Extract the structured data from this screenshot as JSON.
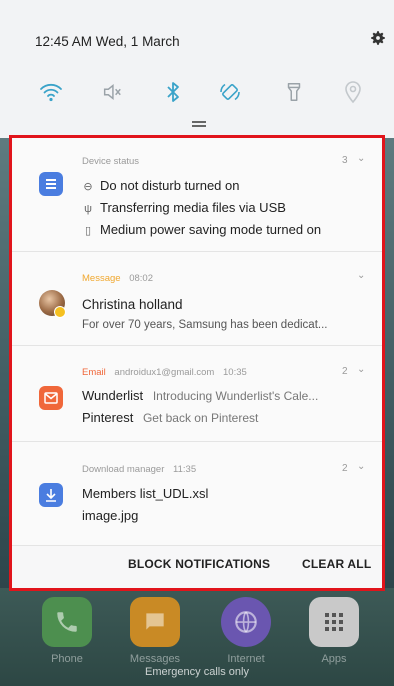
{
  "status_bar": {
    "time_date": "12:45 AM  Wed, 1 March"
  },
  "quick_settings": {
    "icons": [
      "wifi-icon",
      "sound-off-icon",
      "bluetooth-icon",
      "auto-rotate-icon",
      "flashlight-icon",
      "location-icon"
    ],
    "accent_color": "#3aa3c9"
  },
  "notifications": {
    "device_status": {
      "header": "Device status",
      "count": "3",
      "lines": [
        {
          "icon": "do-not-disturb-icon",
          "text": "Do not disturb turned on"
        },
        {
          "icon": "usb-icon",
          "text": "Transferring media files via USB"
        },
        {
          "icon": "battery-icon",
          "text": "Medium power saving mode turned on"
        }
      ]
    },
    "message": {
      "app": "Message",
      "time": "08:02",
      "title": "Christina holland",
      "body": "For over 70 years, Samsung has been dedicat..."
    },
    "email": {
      "app": "Email",
      "account": "androidux1@gmail.com",
      "time": "10:35",
      "count": "2",
      "rows": [
        {
          "sender": "Wunderlist",
          "subject": "Introducing Wunderlist's Cale..."
        },
        {
          "sender": "Pinterest",
          "subject": "Get back on Pinterest"
        }
      ]
    },
    "download": {
      "app": "Download manager",
      "time": "11:35",
      "count": "2",
      "files": [
        "Members list_UDL.xsl",
        "image.jpg"
      ]
    }
  },
  "actions": {
    "block": "BLOCK NOTIFICATIONS",
    "clear": "CLEAR ALL"
  },
  "dock": {
    "apps": [
      {
        "label": "Phone",
        "color": "#4d8f4f"
      },
      {
        "label": "Messages",
        "color": "#c98a25"
      },
      {
        "label": "Internet",
        "color": "#6a56b0"
      },
      {
        "label": "Apps",
        "color": "#c9c9c9"
      }
    ],
    "emergency": "Emergency calls only"
  },
  "colors": {
    "highlight_border": "#e1141b",
    "device_icon": "#4a7de0",
    "email_icon": "#f0673a",
    "download_icon": "#4a7de0",
    "app_label_orange": "#f0a830"
  }
}
